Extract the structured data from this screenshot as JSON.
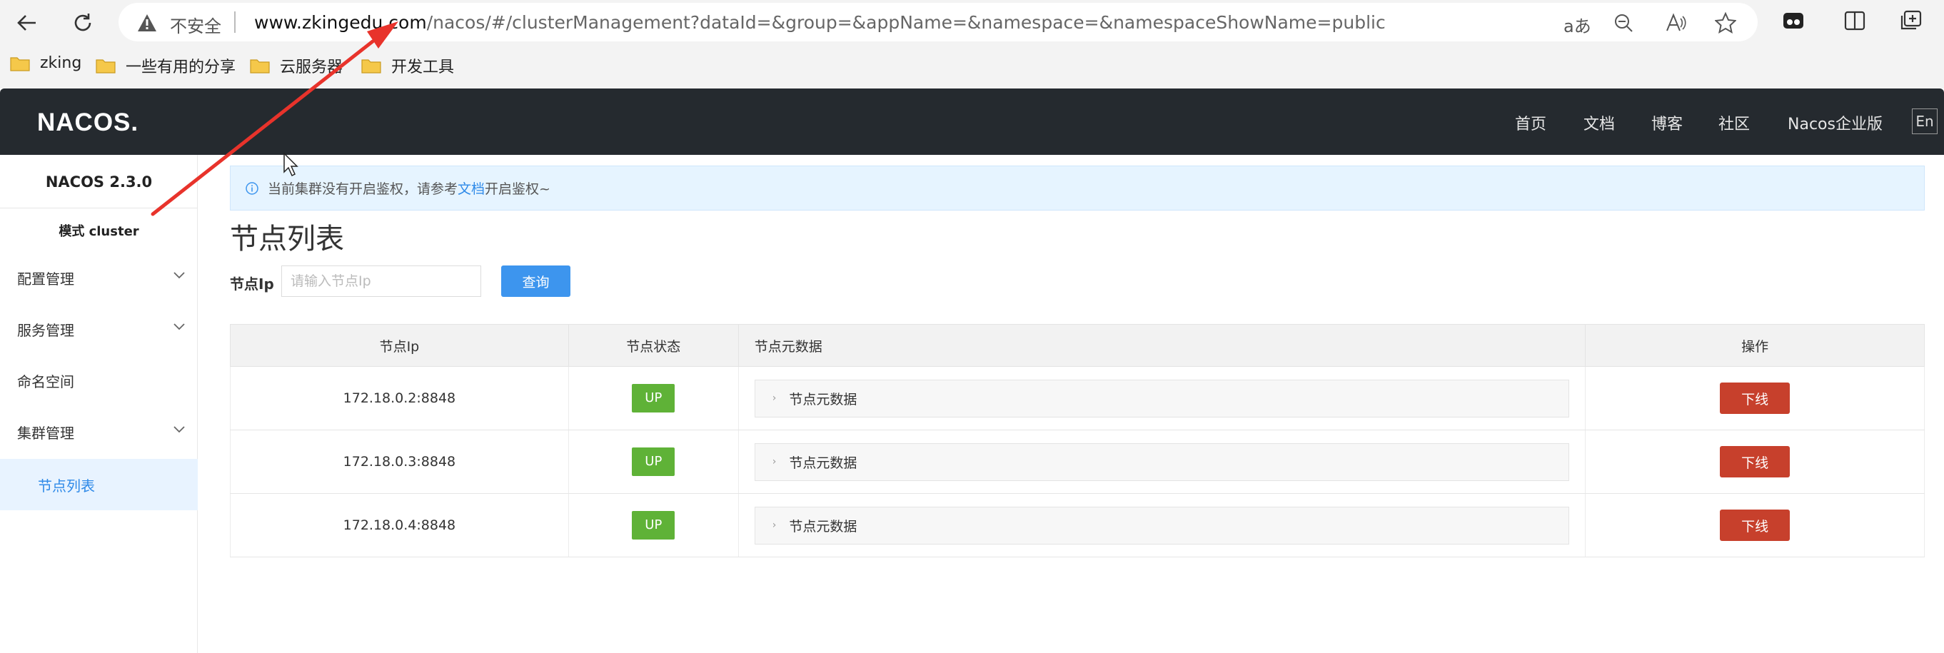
{
  "browser": {
    "insecure_label": "不安全",
    "url_domain": "www.zkingedu.com",
    "url_path": "/nacos/#/clusterManagement?dataId=&group=&appName=&namespace=&namespaceShowName=public",
    "read_aloud_label": "aあ",
    "bookmarks": [
      {
        "label": "zking"
      },
      {
        "label": "一些有用的分享"
      },
      {
        "label": "云服务器"
      },
      {
        "label": "开发工具"
      }
    ]
  },
  "header": {
    "logo": "NACOS.",
    "nav": [
      "首页",
      "文档",
      "博客",
      "社区",
      "Nacos企业版"
    ],
    "lang": "En"
  },
  "sidebar": {
    "version": "NACOS 2.3.0",
    "mode": "模式 cluster",
    "items": [
      {
        "label": "配置管理"
      },
      {
        "label": "服务管理"
      },
      {
        "label": "命名空间"
      },
      {
        "label": "集群管理"
      },
      {
        "label": "节点列表"
      }
    ]
  },
  "main": {
    "alert": {
      "prefix": "当前集群没有开启鉴权，请参考",
      "link": "文档",
      "suffix": "开启鉴权~"
    },
    "title": "节点列表",
    "filter": {
      "label": "节点Ip",
      "placeholder": "请输入节点Ip",
      "button": "查询"
    },
    "table": {
      "columns": [
        "节点Ip",
        "节点状态",
        "节点元数据",
        "操作"
      ],
      "rows": [
        {
          "ip": "172.18.0.2:8848",
          "status": "UP",
          "meta": "节点元数据",
          "action": "下线"
        },
        {
          "ip": "172.18.0.3:8848",
          "status": "UP",
          "meta": "节点元数据",
          "action": "下线"
        },
        {
          "ip": "172.18.0.4:8848",
          "status": "UP",
          "meta": "节点元数据",
          "action": "下线"
        }
      ]
    }
  },
  "colors": {
    "header_bg": "#252a2f",
    "accent_blue": "#3d95ee",
    "status_up": "#5fb237",
    "offline_red": "#c7402c",
    "annotation_arrow": "#e8332b"
  }
}
